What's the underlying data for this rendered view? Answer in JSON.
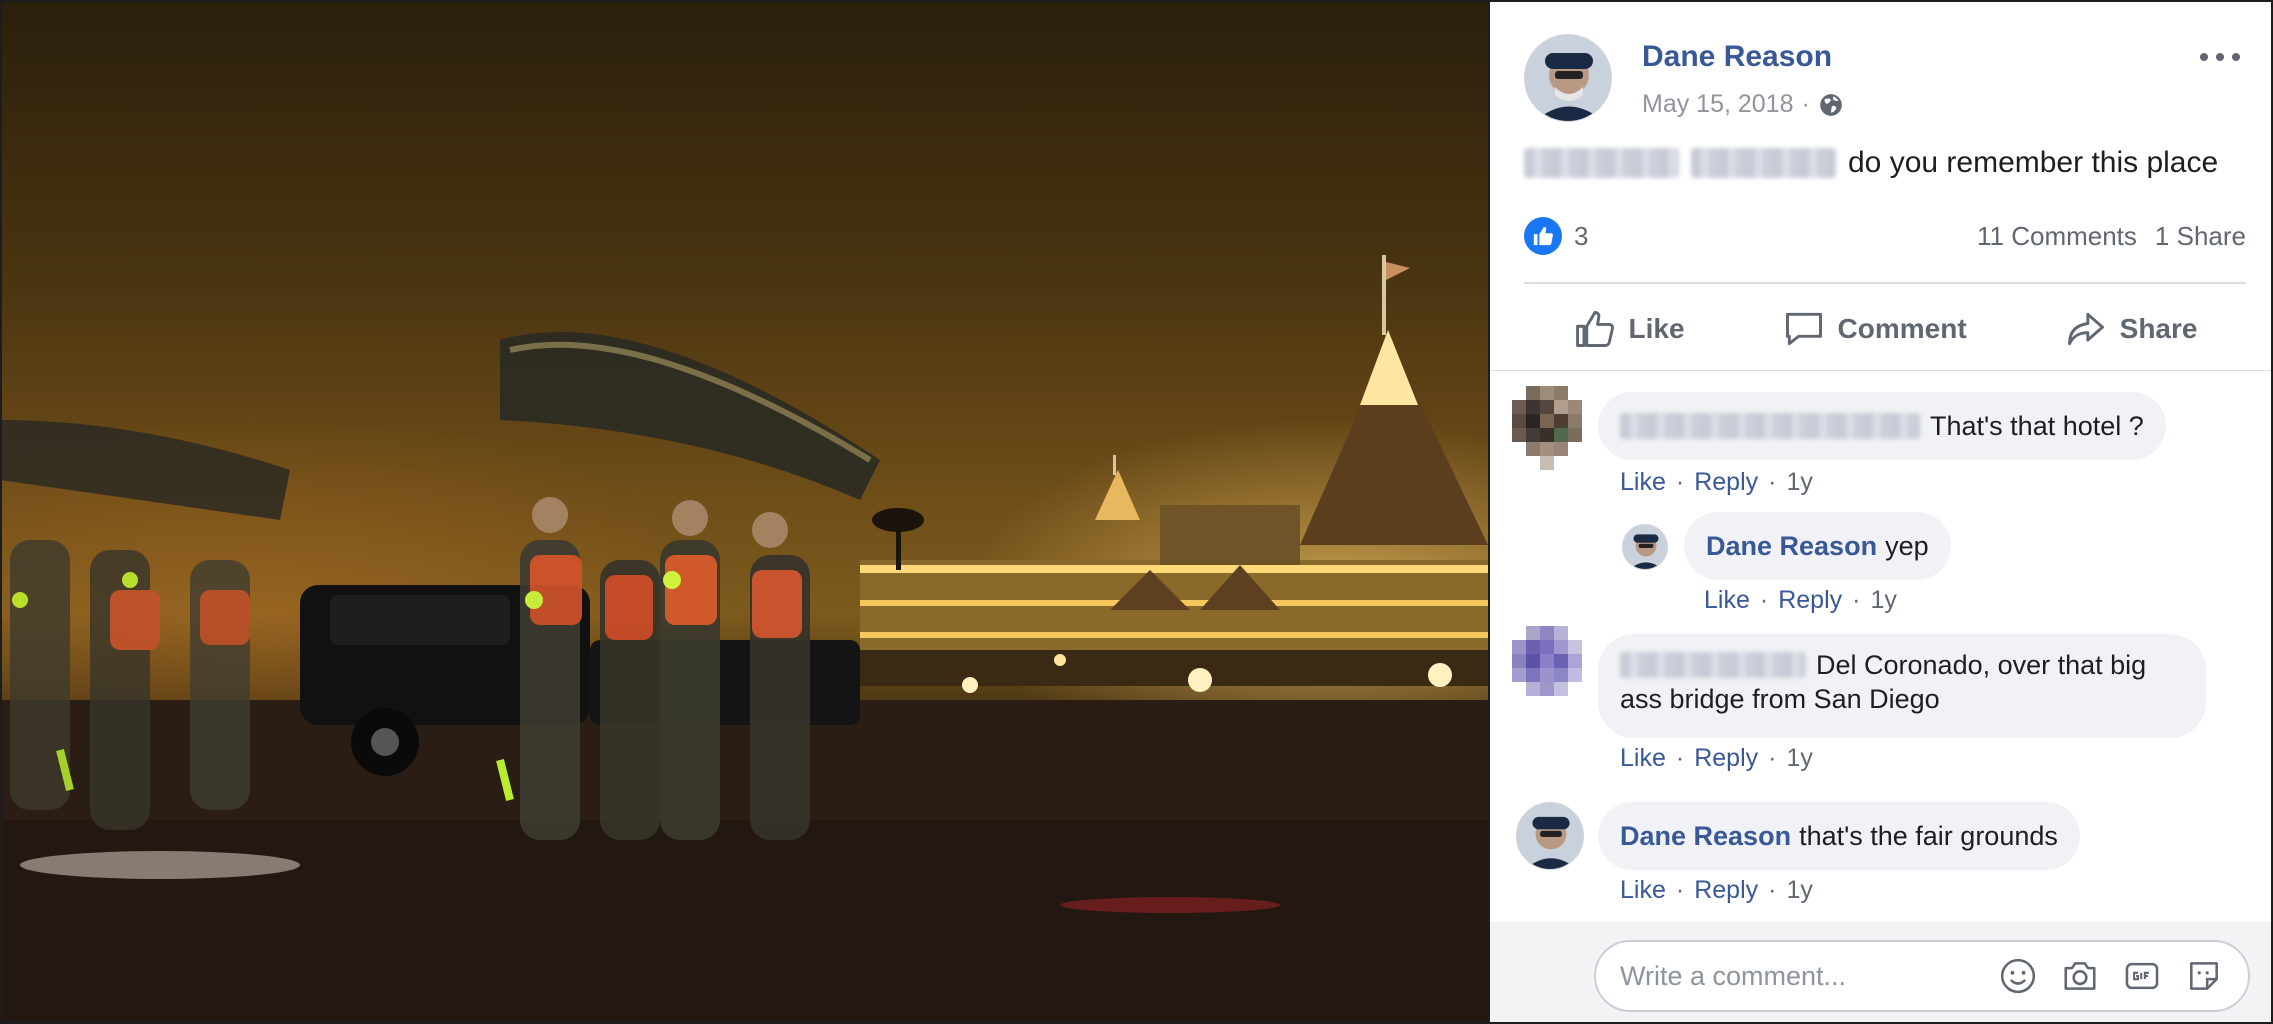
{
  "photo": {
    "description_icon": "night-beach-hotel-photo"
  },
  "post": {
    "author": "Dane Reason",
    "date": "May 15, 2018",
    "date_separator": "·",
    "text": "do you remember this place",
    "like_count": "3",
    "comments_count": "11 Comments",
    "shares_count": "1 Share"
  },
  "actions": {
    "like": "Like",
    "comment": "Comment",
    "share": "Share"
  },
  "comments": [
    {
      "author": "",
      "text": "That's that hotel ?",
      "like": "Like",
      "reply": "Reply",
      "time": "1y"
    },
    {
      "author": "Dane Reason",
      "text": "yep",
      "like": "Like",
      "reply": "Reply",
      "time": "1y"
    },
    {
      "author": "",
      "text_line1": "Del Coronado, over that big",
      "text_line2": "ass bridge from San Diego",
      "like": "Like",
      "reply": "Reply",
      "time": "1y"
    },
    {
      "author": "Dane Reason",
      "text": "that's the fair grounds",
      "like": "Like",
      "reply": "Reply",
      "time": "1y"
    }
  ],
  "composer": {
    "placeholder": "Write a comment...",
    "icons": [
      "emoji-icon",
      "camera-icon",
      "gif-icon",
      "sticker-icon"
    ]
  },
  "colors": {
    "link": "#385898",
    "like_blue": "#1877f2",
    "bubble": "#f0f2f5",
    "muted": "#606770"
  },
  "dot": "·"
}
